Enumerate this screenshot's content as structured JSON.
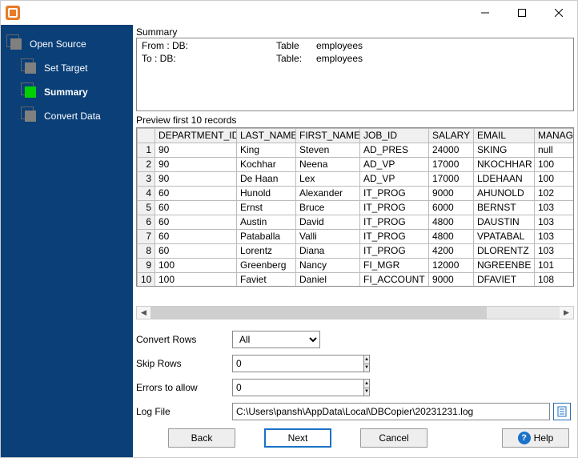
{
  "nav": {
    "open_source": "Open Source",
    "set_target": "Set Target",
    "summary": "Summary",
    "convert_data": "Convert Data"
  },
  "summary": {
    "section_label": "Summary",
    "from_label": "From : DB:",
    "from_table_label": "Table",
    "from_table_value": "employees",
    "to_label": "To : DB:",
    "to_table_label": "Table:",
    "to_table_value": "employees"
  },
  "preview": {
    "label": "Preview first 10 records",
    "columns": [
      "DEPARTMENT_ID",
      "LAST_NAME",
      "FIRST_NAME",
      "JOB_ID",
      "SALARY",
      "EMAIL",
      "MANAG"
    ],
    "rows": [
      {
        "n": "1",
        "dept": "90",
        "last": "King",
        "first": "Steven",
        "job": "AD_PRES",
        "sal": "24000",
        "email": "SKING",
        "man": "null"
      },
      {
        "n": "2",
        "dept": "90",
        "last": "Kochhar",
        "first": "Neena",
        "job": "AD_VP",
        "sal": "17000",
        "email": "NKOCHHAR",
        "man": "100"
      },
      {
        "n": "3",
        "dept": "90",
        "last": "De Haan",
        "first": "Lex",
        "job": "AD_VP",
        "sal": "17000",
        "email": "LDEHAAN",
        "man": "100"
      },
      {
        "n": "4",
        "dept": "60",
        "last": "Hunold",
        "first": "Alexander",
        "job": "IT_PROG",
        "sal": "9000",
        "email": "AHUNOLD",
        "man": "102"
      },
      {
        "n": "5",
        "dept": "60",
        "last": "Ernst",
        "first": "Bruce",
        "job": "IT_PROG",
        "sal": "6000",
        "email": "BERNST",
        "man": "103"
      },
      {
        "n": "6",
        "dept": "60",
        "last": "Austin",
        "first": "David",
        "job": "IT_PROG",
        "sal": "4800",
        "email": "DAUSTIN",
        "man": "103"
      },
      {
        "n": "7",
        "dept": "60",
        "last": "Pataballa",
        "first": "Valli",
        "job": "IT_PROG",
        "sal": "4800",
        "email": "VPATABAL",
        "man": "103"
      },
      {
        "n": "8",
        "dept": "60",
        "last": "Lorentz",
        "first": "Diana",
        "job": "IT_PROG",
        "sal": "4200",
        "email": "DLORENTZ",
        "man": "103"
      },
      {
        "n": "9",
        "dept": "100",
        "last": "Greenberg",
        "first": "Nancy",
        "job": "FI_MGR",
        "sal": "12000",
        "email": "NGREENBE",
        "man": "101"
      },
      {
        "n": "10",
        "dept": "100",
        "last": "Faviet",
        "first": "Daniel",
        "job": "FI_ACCOUNT",
        "sal": "9000",
        "email": "DFAVIET",
        "man": "108"
      }
    ]
  },
  "form": {
    "convert_rows_label": "Convert Rows",
    "convert_rows_value": "All",
    "skip_rows_label": "Skip Rows",
    "skip_rows_value": "0",
    "errors_label": "Errors to allow",
    "errors_value": "0",
    "log_file_label": "Log File",
    "log_file_value": "C:\\Users\\pansh\\AppData\\Local\\DBCopier\\20231231.log"
  },
  "footer": {
    "back": "Back",
    "next": "Next",
    "cancel": "Cancel",
    "help": "Help"
  }
}
